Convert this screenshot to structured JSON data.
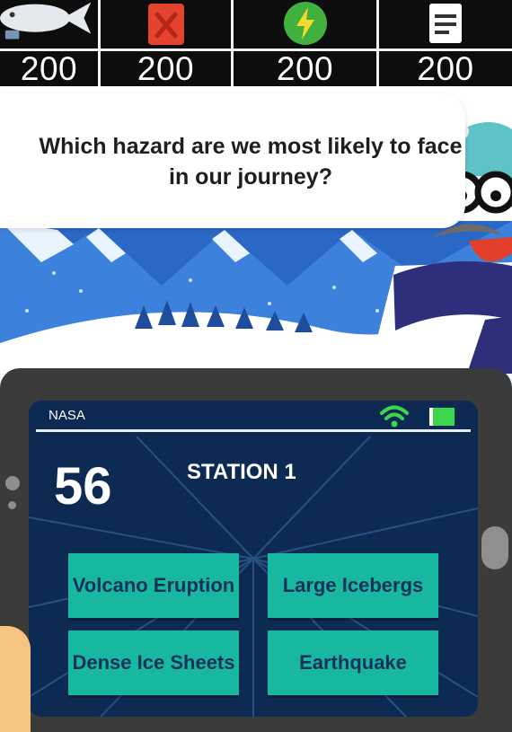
{
  "colors": {
    "accent_answer": "#17b7a0",
    "answer_text": "#16315a",
    "screen_bg": "#0c2a52",
    "battery": "#3dd64f",
    "signal": "#3dd64f"
  },
  "resources": [
    {
      "icon": "fish-icon",
      "value": "200"
    },
    {
      "icon": "fuel-can-icon",
      "value": "200"
    },
    {
      "icon": "energy-bolt-icon",
      "value": "200"
    },
    {
      "icon": "document-icon",
      "value": "200"
    }
  ],
  "dialog": {
    "question": "Which hazard are we most likely to face in our journey?"
  },
  "tablet": {
    "brand": "NASA",
    "timer": "56",
    "station": "STATION 1",
    "answers": [
      "Volcano Eruption",
      "Large Icebergs",
      "Dense Ice Sheets",
      "Earthquake"
    ]
  }
}
